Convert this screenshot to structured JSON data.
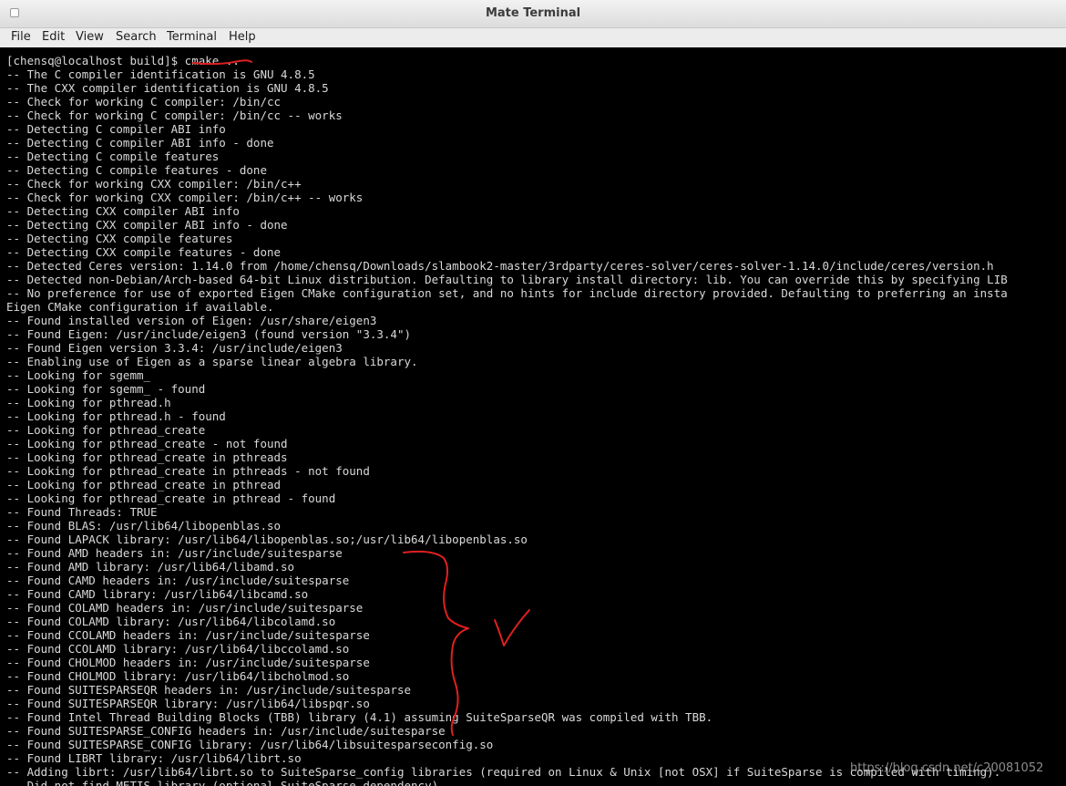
{
  "window": {
    "title": "Mate Terminal",
    "icon": "window-menu-icon"
  },
  "menubar": {
    "items": [
      "File",
      "Edit",
      "View",
      "Search",
      "Terminal",
      "Help"
    ]
  },
  "terminal": {
    "lines": [
      "[chensq@localhost build]$ cmake ..",
      "-- The C compiler identification is GNU 4.8.5",
      "-- The CXX compiler identification is GNU 4.8.5",
      "-- Check for working C compiler: /bin/cc",
      "-- Check for working C compiler: /bin/cc -- works",
      "-- Detecting C compiler ABI info",
      "-- Detecting C compiler ABI info - done",
      "-- Detecting C compile features",
      "-- Detecting C compile features - done",
      "-- Check for working CXX compiler: /bin/c++",
      "-- Check for working CXX compiler: /bin/c++ -- works",
      "-- Detecting CXX compiler ABI info",
      "-- Detecting CXX compiler ABI info - done",
      "-- Detecting CXX compile features",
      "-- Detecting CXX compile features - done",
      "-- Detected Ceres version: 1.14.0 from /home/chensq/Downloads/slambook2-master/3rdparty/ceres-solver/ceres-solver-1.14.0/include/ceres/version.h",
      "-- Detected non-Debian/Arch-based 64-bit Linux distribution. Defaulting to library install directory: lib. You can override this by specifying LIB",
      "-- No preference for use of exported Eigen CMake configuration set, and no hints for include directory provided. Defaulting to preferring an insta",
      "Eigen CMake configuration if available.",
      "-- Found installed version of Eigen: /usr/share/eigen3",
      "-- Found Eigen: /usr/include/eigen3 (found version \"3.3.4\")",
      "-- Found Eigen version 3.3.4: /usr/include/eigen3",
      "-- Enabling use of Eigen as a sparse linear algebra library.",
      "-- Looking for sgemm_",
      "-- Looking for sgemm_ - found",
      "-- Looking for pthread.h",
      "-- Looking for pthread.h - found",
      "-- Looking for pthread_create",
      "-- Looking for pthread_create - not found",
      "-- Looking for pthread_create in pthreads",
      "-- Looking for pthread_create in pthreads - not found",
      "-- Looking for pthread_create in pthread",
      "-- Looking for pthread_create in pthread - found",
      "-- Found Threads: TRUE",
      "-- Found BLAS: /usr/lib64/libopenblas.so",
      "-- Found LAPACK library: /usr/lib64/libopenblas.so;/usr/lib64/libopenblas.so",
      "-- Found AMD headers in: /usr/include/suitesparse",
      "-- Found AMD library: /usr/lib64/libamd.so",
      "-- Found CAMD headers in: /usr/include/suitesparse",
      "-- Found CAMD library: /usr/lib64/libcamd.so",
      "-- Found COLAMD headers in: /usr/include/suitesparse",
      "-- Found COLAMD library: /usr/lib64/libcolamd.so",
      "-- Found CCOLAMD headers in: /usr/include/suitesparse",
      "-- Found CCOLAMD library: /usr/lib64/libccolamd.so",
      "-- Found CHOLMOD headers in: /usr/include/suitesparse",
      "-- Found CHOLMOD library: /usr/lib64/libcholmod.so",
      "-- Found SUITESPARSEQR headers in: /usr/include/suitesparse",
      "-- Found SUITESPARSEQR library: /usr/lib64/libspqr.so",
      "-- Found Intel Thread Building Blocks (TBB) library (4.1) assuming SuiteSparseQR was compiled with TBB.",
      "-- Found SUITESPARSE_CONFIG headers in: /usr/include/suitesparse",
      "-- Found SUITESPARSE_CONFIG library: /usr/lib64/libsuitesparseconfig.so",
      "-- Found LIBRT library: /usr/lib64/librt.so",
      "-- Adding librt: /usr/lib64/librt.so to SuiteSparse_config libraries (required on Linux & Unix [not OSX] if SuiteSparse is compiled with timing).",
      "-- Did not find METIS library (optional SuiteSparse dependency)"
    ]
  },
  "annotations": {
    "color": "#e02020",
    "marks": [
      "underline-on-cmake",
      "curly-brace",
      "check-mark"
    ]
  },
  "watermark": "https://blog.csdn.net/c20081052"
}
